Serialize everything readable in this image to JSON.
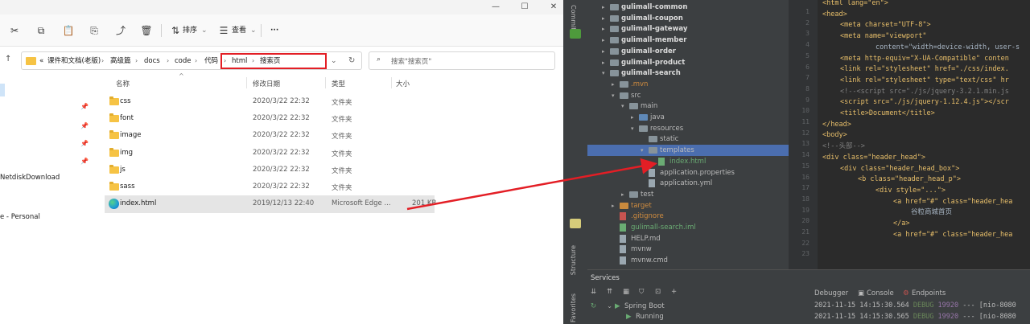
{
  "explorer": {
    "window_controls": {
      "minimize": "—",
      "maximize": "☐",
      "close": "✕"
    },
    "toolbar": {
      "sort_label": "排序",
      "view_label": "查看",
      "more_label": "···"
    },
    "address": {
      "overflow": "«",
      "crumbs": [
        "课件和文档(老版)",
        "高级篇",
        "docs",
        "code",
        "代码",
        "html",
        "搜索页"
      ]
    },
    "search": {
      "placeholder": "搜索\"搜索页\""
    },
    "nav": {
      "items": [
        "NetdiskDownload",
        "e - Personal"
      ]
    },
    "columns": {
      "name": "名称",
      "date": "修改日期",
      "type": "类型",
      "size": "大小"
    },
    "files": [
      {
        "name": "css",
        "date": "2020/3/22 22:32",
        "type": "文件夹",
        "size": "",
        "kind": "folder"
      },
      {
        "name": "font",
        "date": "2020/3/22 22:32",
        "type": "文件夹",
        "size": "",
        "kind": "folder"
      },
      {
        "name": "image",
        "date": "2020/3/22 22:32",
        "type": "文件夹",
        "size": "",
        "kind": "folder"
      },
      {
        "name": "img",
        "date": "2020/3/22 22:32",
        "type": "文件夹",
        "size": "",
        "kind": "folder"
      },
      {
        "name": "js",
        "date": "2020/3/22 22:32",
        "type": "文件夹",
        "size": "",
        "kind": "folder"
      },
      {
        "name": "sass",
        "date": "2020/3/22 22:32",
        "type": "文件夹",
        "size": "",
        "kind": "folder"
      },
      {
        "name": "index.html",
        "date": "2019/12/13 22:40",
        "type": "Microsoft Edge ...",
        "size": "201 KB",
        "kind": "edge"
      }
    ]
  },
  "ide": {
    "side_tab": "Commit",
    "structure_tab": "Structure",
    "favorites_tab": "Favorites",
    "tree": [
      {
        "label": "gulimall-common",
        "indent": 0,
        "kind": "module"
      },
      {
        "label": "gulimall-coupon",
        "indent": 0,
        "kind": "module"
      },
      {
        "label": "gulimall-gateway",
        "indent": 0,
        "kind": "module"
      },
      {
        "label": "gulimall-member",
        "indent": 0,
        "kind": "module"
      },
      {
        "label": "gulimall-order",
        "indent": 0,
        "kind": "module"
      },
      {
        "label": "gulimall-product",
        "indent": 0,
        "kind": "module"
      },
      {
        "label": "gulimall-search",
        "indent": 0,
        "kind": "module-open"
      },
      {
        "label": ".mvn",
        "indent": 1,
        "kind": "folder"
      },
      {
        "label": "src",
        "indent": 1,
        "kind": "folder-open"
      },
      {
        "label": "main",
        "indent": 2,
        "kind": "folder-open"
      },
      {
        "label": "java",
        "indent": 3,
        "kind": "folder-blue"
      },
      {
        "label": "resources",
        "indent": 3,
        "kind": "folder-open"
      },
      {
        "label": "static",
        "indent": 4,
        "kind": "folder-leaf"
      },
      {
        "label": "templates",
        "indent": 4,
        "kind": "folder-selected"
      },
      {
        "label": "index.html",
        "indent": 5,
        "kind": "file-green"
      },
      {
        "label": "application.properties",
        "indent": 4,
        "kind": "file"
      },
      {
        "label": "application.yml",
        "indent": 4,
        "kind": "file"
      },
      {
        "label": "test",
        "indent": 2,
        "kind": "folder"
      },
      {
        "label": "target",
        "indent": 1,
        "kind": "folder-orange"
      },
      {
        "label": ".gitignore",
        "indent": 1,
        "kind": "file-orange"
      },
      {
        "label": "gulimall-search.iml",
        "indent": 1,
        "kind": "file-green"
      },
      {
        "label": "HELP.md",
        "indent": 1,
        "kind": "file"
      },
      {
        "label": "mvnw",
        "indent": 1,
        "kind": "file"
      },
      {
        "label": "mvnw.cmd",
        "indent": 1,
        "kind": "file"
      }
    ],
    "line_numbers": [
      "1",
      "2",
      "3",
      "4",
      "5",
      "6",
      "7",
      "8",
      "9",
      "10",
      "11",
      "12",
      "13",
      "14",
      "15",
      "16",
      "17",
      "18",
      "19",
      "20",
      "21",
      "22",
      "23"
    ],
    "code": [
      {
        "text": "<html lang=\"en\">",
        "indent": 0
      },
      {
        "text": "<head>",
        "indent": 0
      },
      {
        "text": "<meta charset=\"UTF-8\">",
        "indent": 1
      },
      {
        "text": "<meta name=\"viewport\"",
        "indent": 1
      },
      {
        "text": "content=\"width=device-width, user-s",
        "indent": 3
      },
      {
        "text": "<meta http-equiv=\"X-UA-Compatible\" conten",
        "indent": 1
      },
      {
        "text": "<link rel=\"stylesheet\" href=\"./css/index.",
        "indent": 1
      },
      {
        "text": "<link rel=\"stylesheet\" type=\"text/css\" hr",
        "indent": 1
      },
      {
        "text": "<!--<script src=\"./js/jquery-3.2.1.min.js",
        "indent": 1
      },
      {
        "text": "<script src=\"./js/jquery-1.12.4.js\"></scr",
        "indent": 1
      },
      {
        "text": "<title>Document</title>",
        "indent": 1
      },
      {
        "text": "</head>",
        "indent": 0
      },
      {
        "text": "<body>",
        "indent": 0
      },
      {
        "text": "<!--头部-->",
        "indent": 0
      },
      {
        "text": "<div class=\"header_head\">",
        "indent": 0
      },
      {
        "text": "<div class=\"header_head_box\">",
        "indent": 1
      },
      {
        "text": "<b class=\"header_head_p\">",
        "indent": 2
      },
      {
        "text": "<div style=\"...\">",
        "indent": 3
      },
      {
        "text": "<a href=\"#\" class=\"header_hea",
        "indent": 4
      },
      {
        "text": "谷粒商城首页",
        "indent": 5
      },
      {
        "text": "</a>",
        "indent": 4
      },
      {
        "text": "<a href=\"#\" class=\"header_hea",
        "indent": 4
      }
    ],
    "services": {
      "title": "Services",
      "tabs": [
        "Debugger",
        "Console",
        "Endpoints"
      ],
      "items": [
        "Spring Boot",
        "Running"
      ],
      "logs": [
        {
          "time": "2021-11-15 14:15:30.564",
          "level": "DEBUG",
          "pid": "19920",
          "rest": "--- [nio-8080"
        },
        {
          "time": "2021-11-15 14:15:30.565",
          "level": "DEBUG",
          "pid": "19920",
          "rest": "--- [nio-8080"
        }
      ]
    }
  }
}
